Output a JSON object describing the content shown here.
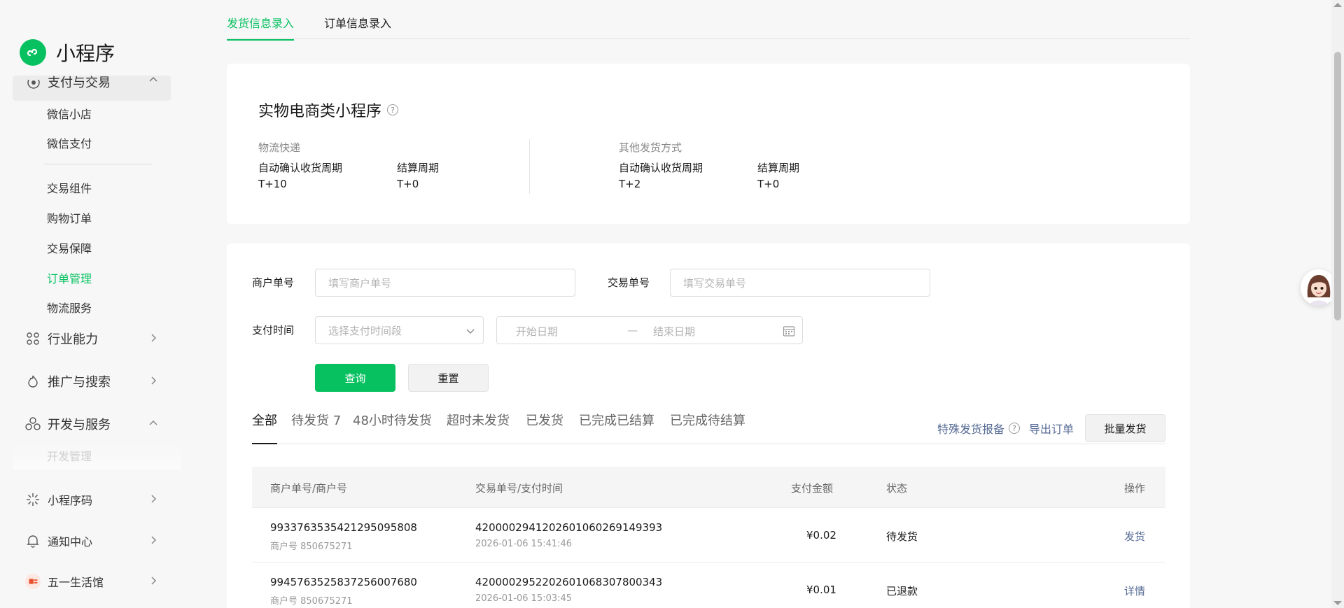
{
  "app": {
    "title": "小程序"
  },
  "sidebar": {
    "cut_item": {
      "label": "支付与交易"
    },
    "sub_items": [
      {
        "label": "微信小店"
      },
      {
        "label": "微信支付"
      },
      {
        "label": "交易组件"
      },
      {
        "label": "购物订单"
      },
      {
        "label": "交易保障"
      },
      {
        "label": "订单管理",
        "active": true
      },
      {
        "label": "物流服务"
      }
    ],
    "nav_items": [
      {
        "label": "行业能力",
        "icon": "industry-icon"
      },
      {
        "label": "推广与搜索",
        "icon": "flame-icon"
      },
      {
        "label": "开发与服务",
        "icon": "dev-icon",
        "expanded": true
      }
    ],
    "faded_item": {
      "label": "开发管理"
    },
    "bottom_items": [
      {
        "label": "小程序码",
        "icon": "qrcode-icon"
      },
      {
        "label": "通知中心",
        "icon": "bell-icon"
      },
      {
        "label": "五一生活馆",
        "icon": "store-avatar-icon"
      }
    ]
  },
  "top_tabs": [
    {
      "label": "发货信息录入",
      "active": true
    },
    {
      "label": "订单信息录入",
      "active": false
    }
  ],
  "summary": {
    "title": "实物电商类小程序",
    "groups": [
      {
        "caption": "物流快递",
        "fields": [
          {
            "key": "自动确认收货周期",
            "value": "T+10"
          },
          {
            "key": "结算周期",
            "value": "T+0"
          }
        ]
      },
      {
        "caption": "其他发货方式",
        "fields": [
          {
            "key": "自动确认收货周期",
            "value": "T+2"
          },
          {
            "key": "结算周期",
            "value": "T+0"
          }
        ]
      }
    ]
  },
  "filters": {
    "merchant_no": {
      "label": "商户单号",
      "placeholder": "填写商户单号"
    },
    "trade_no": {
      "label": "交易单号",
      "placeholder": "填写交易单号"
    },
    "pay_time": {
      "label": "支付时间",
      "select_placeholder": "选择支付时间段",
      "start_placeholder": "开始日期",
      "separator": "—",
      "end_placeholder": "结束日期"
    },
    "query_label": "查询",
    "reset_label": "重置"
  },
  "status_tabs": [
    {
      "label": "全部",
      "active": true
    },
    {
      "label": "待发货 7"
    },
    {
      "label": "48小时待发货"
    },
    {
      "label": "超时未发货"
    },
    {
      "label": "已发货"
    },
    {
      "label": "已完成已结算"
    },
    {
      "label": "已完成待结算"
    }
  ],
  "actions": {
    "special_report": "特殊发货报备",
    "export": "导出订单",
    "batch_ship": "批量发货"
  },
  "table": {
    "headers": {
      "merchant": "商户单号/商户号",
      "trade": "交易单号/支付时间",
      "amount": "支付金额",
      "status": "状态",
      "op": "操作"
    },
    "rows": [
      {
        "merchant_order": "9933763535421295095808",
        "merchant_id": "商户号 850675271",
        "trade_no": "4200002941202601060269149393",
        "pay_time": "2026-01-06 15:41:46",
        "amount": "¥0.02",
        "status": "待发货",
        "action": "发货"
      },
      {
        "merchant_order": "9945763525837256007680",
        "merchant_id": "商户号 850675271",
        "trade_no": "4200002952202601068307800343",
        "pay_time": "2026-01-06 15:03:45",
        "amount": "¥0.01",
        "status": "已退款",
        "action": "详情"
      }
    ]
  },
  "colors": {
    "brand": "#07c160",
    "link": "#576b95"
  }
}
